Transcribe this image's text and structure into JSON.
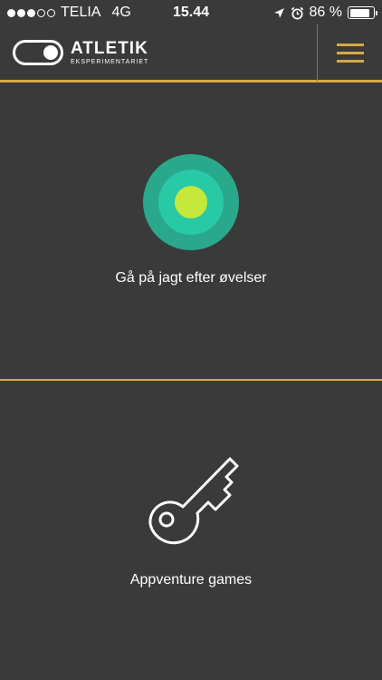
{
  "status_bar": {
    "carrier": "TELIA",
    "network": "4G",
    "time": "15.44",
    "battery_percent_text": "86 %",
    "battery_level": 0.86,
    "signal_bars_filled": 3,
    "signal_bars_total": 5
  },
  "header": {
    "brand_title": "ATLETIK",
    "brand_subtitle": "EKSPERIMENTARIET"
  },
  "sections": {
    "hunt_label": "Gå på jagt efter øvelser",
    "games_label": "Appventure games"
  },
  "colors": {
    "background": "#3a3a3a",
    "accent": "#d6a947",
    "target_outer": "#2aa88c",
    "target_ring": "#27c9a6",
    "target_center": "#c6e83a"
  },
  "icons": {
    "status": [
      "location-arrow-icon",
      "alarm-icon",
      "battery-icon"
    ],
    "header": [
      "toggle-logo-icon",
      "hamburger-menu-icon"
    ],
    "sections": [
      "target-icon",
      "key-icon"
    ]
  }
}
